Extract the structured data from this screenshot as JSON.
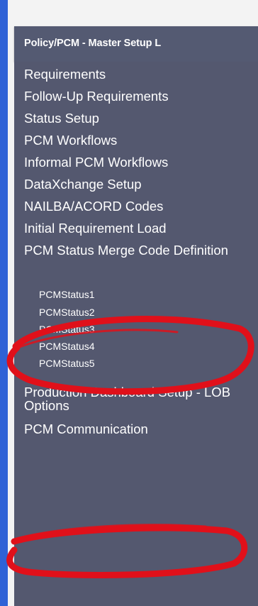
{
  "header": {
    "title": "Policy/PCM - Master Setup L"
  },
  "nav": {
    "items": [
      {
        "label": "Requirements"
      },
      {
        "label": "Follow-Up Requirements"
      },
      {
        "label": "Status Setup"
      },
      {
        "label": "PCM Workflows"
      },
      {
        "label": "Informal PCM Workflows"
      },
      {
        "label": "DataXchange Setup"
      },
      {
        "label": "NAILBA/ACORD Codes"
      },
      {
        "label": "Initial Requirement Load"
      },
      {
        "label": "PCM Status Merge Code Definition"
      },
      {
        "label": "Production Dashboard Setup - LOB Options"
      },
      {
        "label": "PCM Communication"
      }
    ],
    "sub_items": [
      {
        "label": "PCMStatus1"
      },
      {
        "label": "PCMStatus2"
      },
      {
        "label": "PCMStatus3"
      },
      {
        "label": "PCMStatus4"
      },
      {
        "label": "PCMStatus5"
      }
    ]
  },
  "colors": {
    "panel": "#54586f",
    "header": "#545a72",
    "left_edge": "#2f62d6",
    "annotation": "#e0101a"
  }
}
